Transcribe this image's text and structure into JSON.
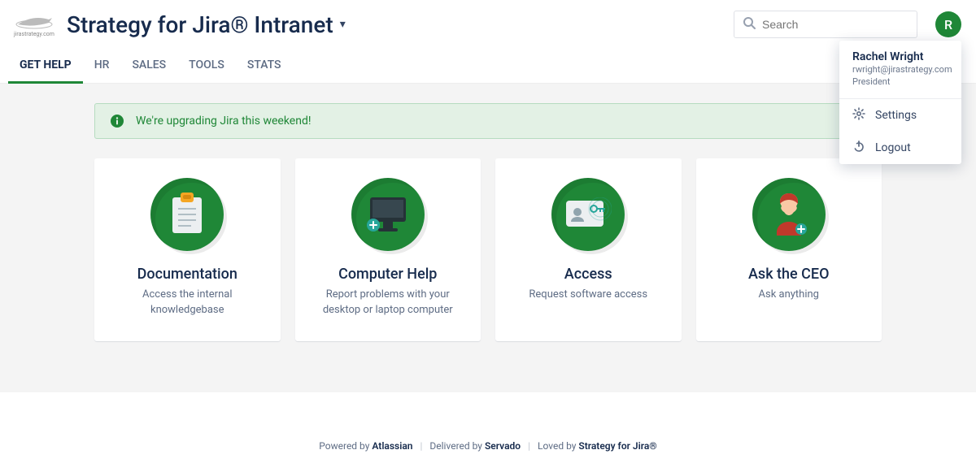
{
  "header": {
    "logo_caption": "jirastrategy.com",
    "site_title": "Strategy for Jira® Intranet",
    "search_placeholder": "Search",
    "avatar_initial": "R"
  },
  "tabs": [
    {
      "label": "GET HELP",
      "active": true
    },
    {
      "label": "HR"
    },
    {
      "label": "SALES"
    },
    {
      "label": "TOOLS"
    },
    {
      "label": "STATS"
    }
  ],
  "banner": {
    "message": "We're upgrading Jira this weekend!"
  },
  "cards": [
    {
      "title": "Documentation",
      "desc": "Access the internal knowledgebase",
      "icon": "clipboard"
    },
    {
      "title": "Computer Help",
      "desc": "Report problems with your desktop or laptop computer",
      "icon": "monitor"
    },
    {
      "title": "Access",
      "desc": "Request software access",
      "icon": "id-card"
    },
    {
      "title": "Ask the CEO",
      "desc": "Ask anything",
      "icon": "person"
    }
  ],
  "user_menu": {
    "name": "Rachel Wright",
    "email": "rwright@jirastrategy.com",
    "role": "President",
    "items": [
      {
        "label": "Settings",
        "icon": "gear"
      },
      {
        "label": "Logout",
        "icon": "power"
      }
    ]
  },
  "footer": {
    "p1": "Powered by ",
    "b1": "Atlassian",
    "p2": "Delivered by ",
    "b2": "Servado",
    "p3": "Loved by ",
    "b3": "Strategy for Jira®"
  }
}
